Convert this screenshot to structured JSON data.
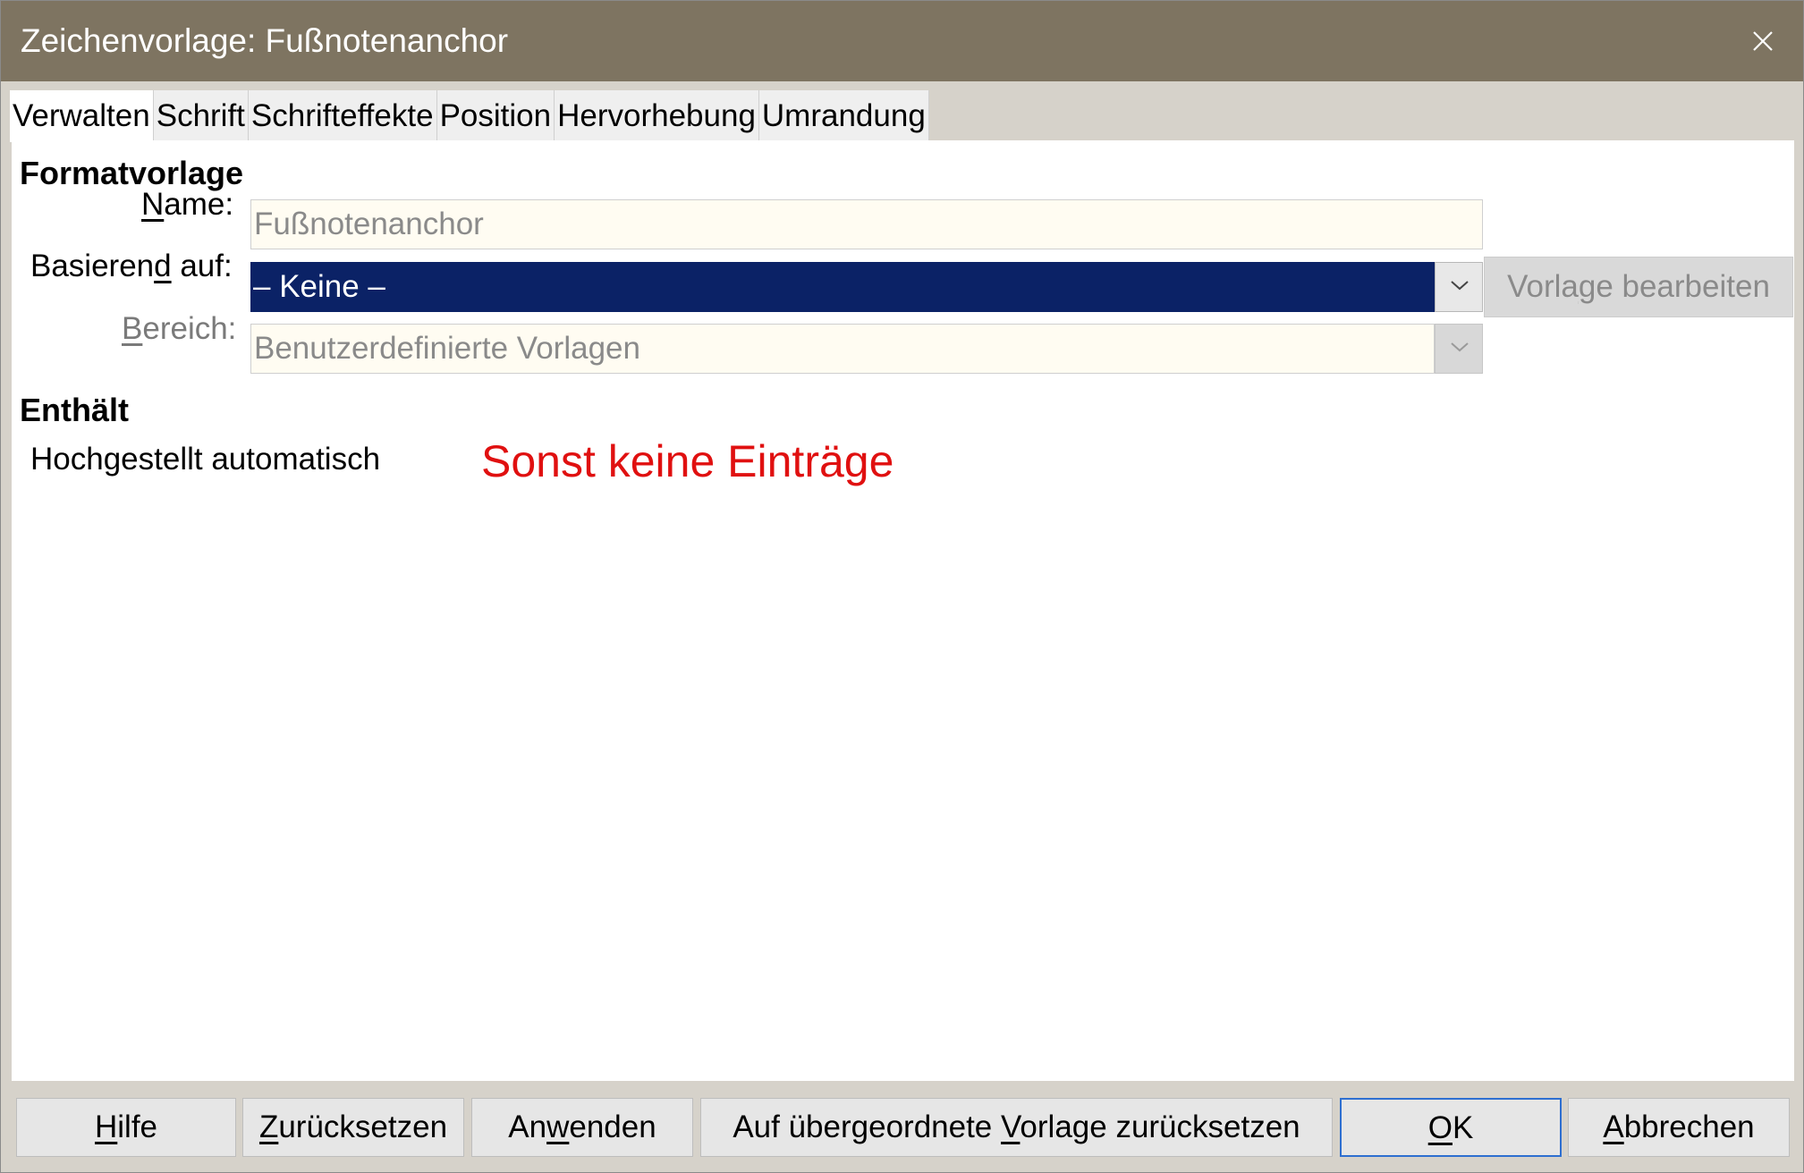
{
  "window": {
    "title": "Zeichenvorlage: Fußnotenanchor"
  },
  "tabs": [
    {
      "label": "Verwalten",
      "active": true
    },
    {
      "label": "Schrift",
      "active": false
    },
    {
      "label": "Schrifteffekte",
      "active": false
    },
    {
      "label": "Position",
      "active": false
    },
    {
      "label": "Hervorhebung",
      "active": false
    },
    {
      "label": "Umrandung",
      "active": false
    }
  ],
  "style_section": {
    "heading": "Formatvorlage",
    "name": {
      "label_mnemonic": "N",
      "label_rest": "ame:",
      "value": "Fußnotenanchor"
    },
    "based_on": {
      "label_before": "Basieren",
      "label_mnemonic": "d",
      "label_after": " auf:",
      "value": "– Keine –",
      "edit_button_before": "Vorla",
      "edit_button_mnemonic": "g",
      "edit_button_after": "e bearbeiten"
    },
    "category": {
      "label_mnemonic": "B",
      "label_rest": "ereich:",
      "value": "Benutzerdefinierte Vorlagen"
    }
  },
  "contains_section": {
    "heading": "Enthält",
    "text": "Hochgestellt automatisch",
    "annotation": "Sonst keine Einträge",
    "annotation_color": "#e01010"
  },
  "buttons": {
    "help": {
      "mnemonic": "H",
      "rest": "ilfe"
    },
    "reset": {
      "mnemonic": "Z",
      "rest": "urücksetzen"
    },
    "apply": {
      "before": "An",
      "mnemonic": "w",
      "after": "enden"
    },
    "reset_parent": {
      "before": "Auf übergeordnete ",
      "mnemonic": "V",
      "after": "orlage zurücksetzen"
    },
    "ok": {
      "mnemonic": "O",
      "rest": "K"
    },
    "cancel": {
      "mnemonic": "A",
      "rest": "bbrechen"
    }
  },
  "colors": {
    "titlebar": "#7e7461",
    "selection": "#0b2266",
    "default_button_border": "#2e6fd0"
  }
}
